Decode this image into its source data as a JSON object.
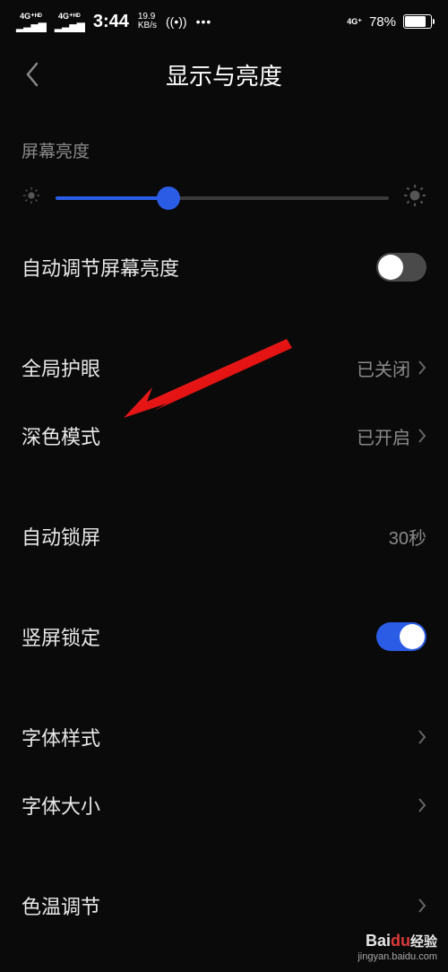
{
  "status": {
    "signal_label": "4G⁺ᴴᴰ",
    "time": "3:44",
    "net_speed_top": "19.9",
    "net_speed_unit": "KB/s",
    "right_signal": "4G⁺",
    "battery_pct": "78%"
  },
  "header": {
    "title": "显示与亮度"
  },
  "sections": {
    "brightness_label": "屏幕亮度",
    "auto_brightness": "自动调节屏幕亮度",
    "eye_care": {
      "label": "全局护眼",
      "value": "已关闭"
    },
    "dark_mode": {
      "label": "深色模式",
      "value": "已开启"
    },
    "auto_lock": {
      "label": "自动锁屏",
      "value": "30秒"
    },
    "orientation_lock": "竖屏锁定",
    "font_style": "字体样式",
    "font_size": "字体大小",
    "color_temp": "色温调节"
  },
  "watermark": {
    "brand_a": "Bai",
    "brand_b": "du",
    "brand_c": "经验",
    "url": "jingyan.baidu.com"
  }
}
